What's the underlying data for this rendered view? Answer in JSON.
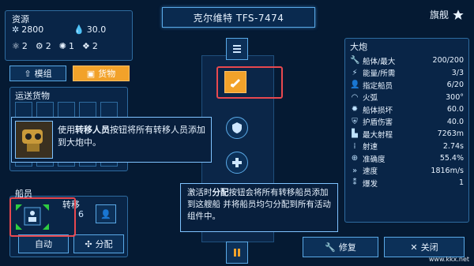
{
  "title": "克尔维特 TFS-7474",
  "flag_label": "旗舰",
  "resources": {
    "label": "资源",
    "credits": "2800",
    "fuel": "30.0",
    "counts": [
      "2",
      "2",
      "1",
      "2"
    ]
  },
  "tabs": [
    {
      "label": "模组",
      "icon": "up-arrow-icon",
      "active": false
    },
    {
      "label": "货物",
      "icon": "box-icon",
      "active": true
    }
  ],
  "cargo": {
    "label": "运送货物"
  },
  "tip_transfer": {
    "prefix": "使用",
    "bold": "转移人员",
    "suffix": "按钮将所有转移人员添加到大炮中。"
  },
  "crew": {
    "label": "船员",
    "transfer_label": "转移",
    "auto_label": "自动",
    "assign_label": "分配"
  },
  "tip_assign": {
    "prefix": "激活时",
    "bold": "分配",
    "suffix": "按钮会将所有转移船员添加到这艘船 并将船员均匀分配到所有活动组件中。"
  },
  "stats": {
    "title": "大炮",
    "rows": [
      {
        "icon": "wrench-icon",
        "label": "船体/最大",
        "value": "200/200"
      },
      {
        "icon": "bolt-icon",
        "label": "能量/所需",
        "value": "3/3"
      },
      {
        "icon": "person-icon",
        "label": "指定船员",
        "value": "6/20"
      },
      {
        "icon": "arc-icon",
        "label": "火弧",
        "value": "300°"
      },
      {
        "icon": "burst-icon",
        "label": "船体损坏",
        "value": "60.0"
      },
      {
        "icon": "shield-icon",
        "label": "护盾伤害",
        "value": "40.0"
      },
      {
        "icon": "range-icon",
        "label": "最大射程",
        "value": "7263m"
      },
      {
        "icon": "rate-icon",
        "label": "射速",
        "value": "2.74s"
      },
      {
        "icon": "target-icon",
        "label": "准确度",
        "value": "55.4%"
      },
      {
        "icon": "speed-icon",
        "label": "速度",
        "value": "1816m/s"
      },
      {
        "icon": "burst2-icon",
        "label": "爆发",
        "value": "1"
      }
    ]
  },
  "buttons": {
    "repair": "修复",
    "close": "关闭"
  },
  "watermark": "www.kkx.net"
}
